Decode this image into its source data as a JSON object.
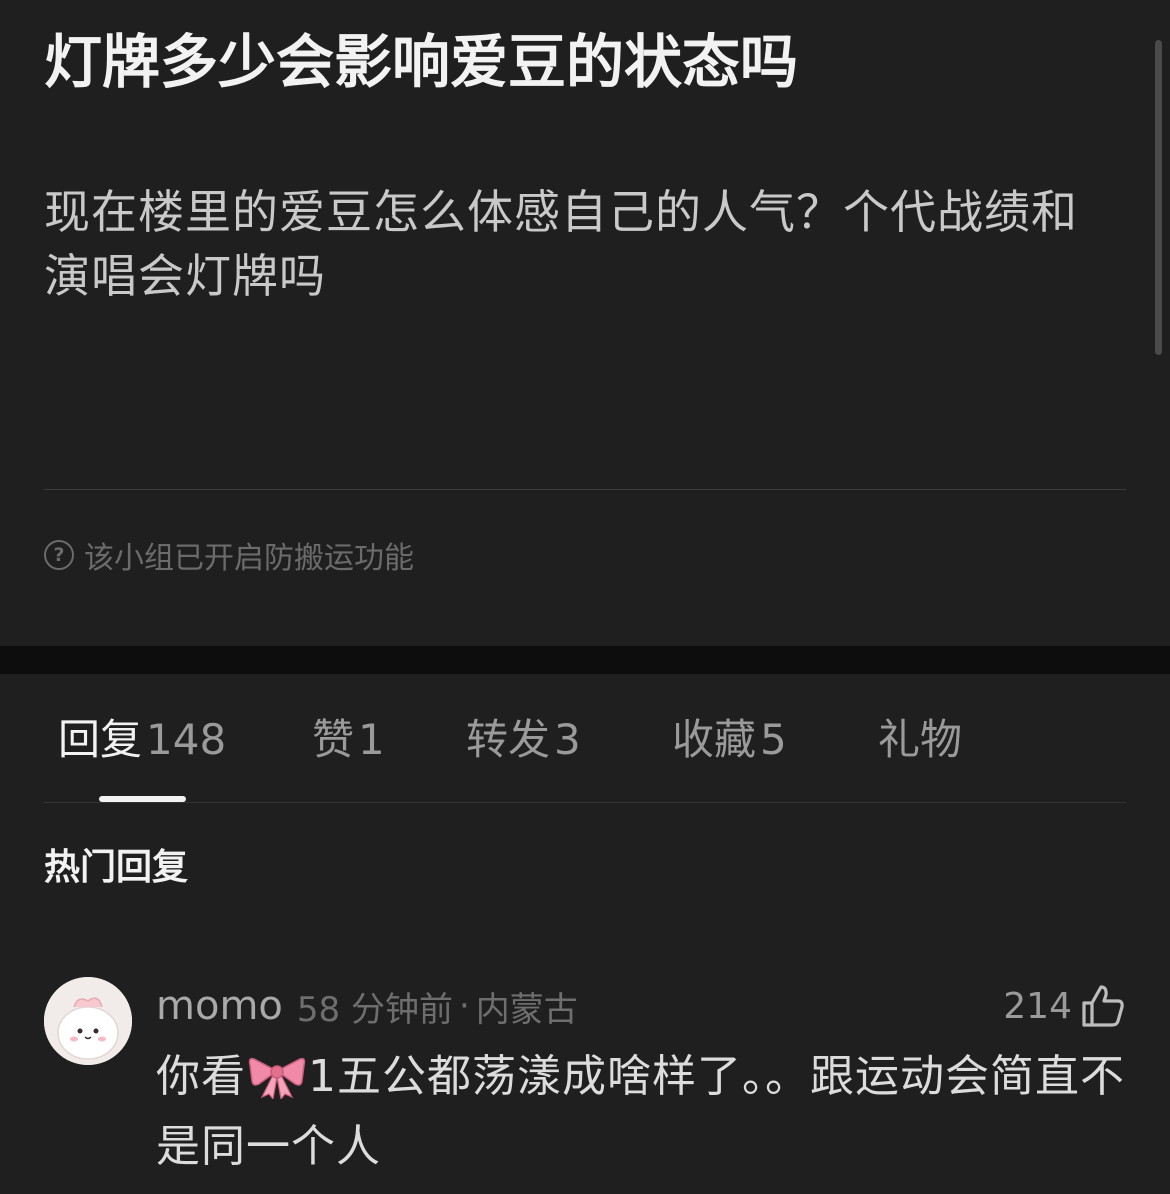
{
  "post": {
    "title": "灯牌多少会影响爱豆的状态吗",
    "body": "现在楼里的爱豆怎么体感自己的人气？个代战绩和演唱会灯牌吗",
    "notice": "该小组已开启防搬运功能",
    "notice_icon": "question-circle-icon"
  },
  "tabs": [
    {
      "label": "回复",
      "count": "148",
      "active": true
    },
    {
      "label": "赞",
      "count": "1"
    },
    {
      "label": "转发",
      "count": "3"
    },
    {
      "label": "收藏",
      "count": "5"
    },
    {
      "label": "礼物",
      "count": ""
    }
  ],
  "hot_section": {
    "title": "热门回复"
  },
  "comment": {
    "username": "momo",
    "time": "58 分钟前",
    "separator": "·",
    "location": "内蒙古",
    "likes": "214",
    "like_icon": "thumbs-up-icon",
    "text_before": "你看",
    "emoji": "ribbon-bow-emoji",
    "text_after": "1五公都荡漾成啥样了。。跟运动会简直不是同一个人"
  },
  "colors": {
    "background": "#1f1f1f",
    "separator_band": "#0d0d0d",
    "title_text": "#f2f2f2",
    "secondary_text": "#9a9a9a",
    "ribbon": "#f08aa8"
  }
}
